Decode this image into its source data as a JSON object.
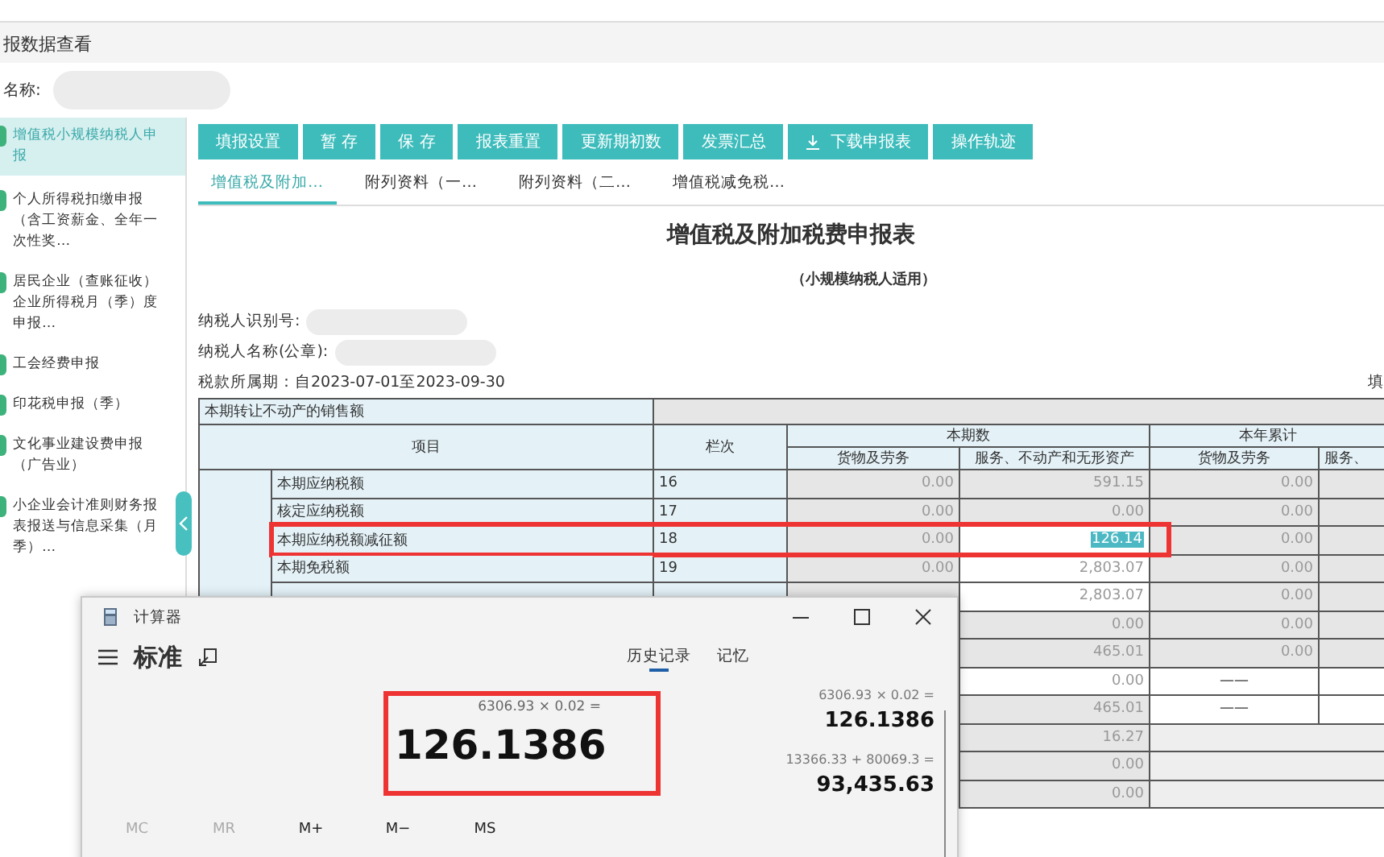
{
  "page_title": "报数据查看",
  "account": {
    "label": "名称:"
  },
  "sidebar": {
    "items": [
      {
        "label": "增值税小规模纳税人申报",
        "selected": true
      },
      {
        "label": "个人所得税扣缴申报（含工资薪金、全年一次性奖…",
        "selected": false
      },
      {
        "label": "居民企业（查账征收）企业所得税月（季）度申报…",
        "selected": false
      },
      {
        "label": "工会经费申报",
        "selected": false
      },
      {
        "label": "印花税申报（季）",
        "selected": false
      },
      {
        "label": "文化事业建设费申报（广告业）",
        "selected": false
      },
      {
        "label": "小企业会计准则财务报表报送与信息采集（月季）…",
        "selected": false
      }
    ]
  },
  "toolbar": {
    "buttons": [
      {
        "label": "填报设置",
        "kind": "plain"
      },
      {
        "label": "暂 存",
        "kind": "plain"
      },
      {
        "label": "保 存",
        "kind": "plain"
      },
      {
        "label": "报表重置",
        "kind": "plain"
      },
      {
        "label": "更新期初数",
        "kind": "plain"
      },
      {
        "label": "发票汇总",
        "kind": "plain"
      },
      {
        "label": "下载申报表",
        "kind": "download"
      },
      {
        "label": "操作轨迹",
        "kind": "plain"
      }
    ]
  },
  "tabs": [
    {
      "label": "增值税及附加…",
      "selected": true
    },
    {
      "label": "附列资料（一…",
      "selected": false
    },
    {
      "label": "附列资料（二…",
      "selected": false
    },
    {
      "label": "增值税减免税…",
      "selected": false
    }
  ],
  "report": {
    "title": "增值税及附加税费申报表",
    "subtitle": "（小规模纳税人适用）",
    "taxpayer_id_label": "纳税人识别号:",
    "taxpayer_name_label": "纳税人名称(公章):",
    "period": "税款所属期：自2023-07-01至2023-09-30",
    "fill_label": "填"
  },
  "table": {
    "first_row": "本期转让不动产的销售额",
    "headers": {
      "item": "项目",
      "line": "栏次",
      "current": "本期数",
      "ytd": "本年累计",
      "goods": "货物及劳务",
      "services": "服务、不动产和无形资产",
      "ytd_goods": "货物及劳务",
      "ytd_services": "服务、"
    },
    "rows": [
      {
        "item": "本期应纳税额",
        "line": "16",
        "goods": "0.00",
        "services": "591.15",
        "ytd_goods": "0.00",
        "editable": false,
        "selected": false
      },
      {
        "item": "核定应纳税额",
        "line": "17",
        "goods": "0.00",
        "services": "0.00",
        "ytd_goods": "0.00",
        "editable": false,
        "selected": false
      },
      {
        "item": "本期应纳税额减征额",
        "line": "18",
        "goods": "0.00",
        "services": "126.14",
        "ytd_goods": "0.00",
        "editable": true,
        "selected": true
      },
      {
        "item": "本期免税额",
        "line": "19",
        "goods": "0.00",
        "services": "2,803.07",
        "ytd_goods": "0.00",
        "editable": true,
        "selected": false
      },
      {
        "services": "2,803.07",
        "ytd_goods": "0.00",
        "editable": true,
        "selected": false
      },
      {
        "services": "0.00",
        "ytd_goods": "0.00",
        "editable": false,
        "selected": false
      },
      {
        "services": "465.01",
        "ytd_goods": "0.00",
        "editable": false,
        "selected": false
      },
      {
        "services": "0.00",
        "ytd_goods": "——",
        "editable": true,
        "selected": false
      },
      {
        "services": "465.01",
        "ytd_goods": "——",
        "editable": false,
        "selected": false
      },
      {
        "services": "16.27",
        "editable": false,
        "selected": false
      },
      {
        "services": "0.00",
        "editable": false,
        "selected": false
      },
      {
        "services": "0.00",
        "editable": false,
        "selected": false
      }
    ]
  },
  "calculator": {
    "title": "计算器",
    "mode": "标准",
    "tabs": [
      {
        "label": "历史记录",
        "selected": true
      },
      {
        "label": "记忆",
        "selected": false
      }
    ],
    "expression": "6306.93 × 0.02 =",
    "result": "126.1386",
    "history": [
      {
        "expression": "6306.93  ×  0.02 =",
        "result": "126.1386"
      },
      {
        "expression": "13366.33  +  80069.3 =",
        "result": "93,435.63"
      }
    ],
    "memory_buttons": [
      {
        "label": "MC",
        "disabled": true
      },
      {
        "label": "MR",
        "disabled": true
      },
      {
        "label": "M+",
        "disabled": false
      },
      {
        "label": "M−",
        "disabled": false
      },
      {
        "label": "MS",
        "disabled": false
      }
    ]
  }
}
